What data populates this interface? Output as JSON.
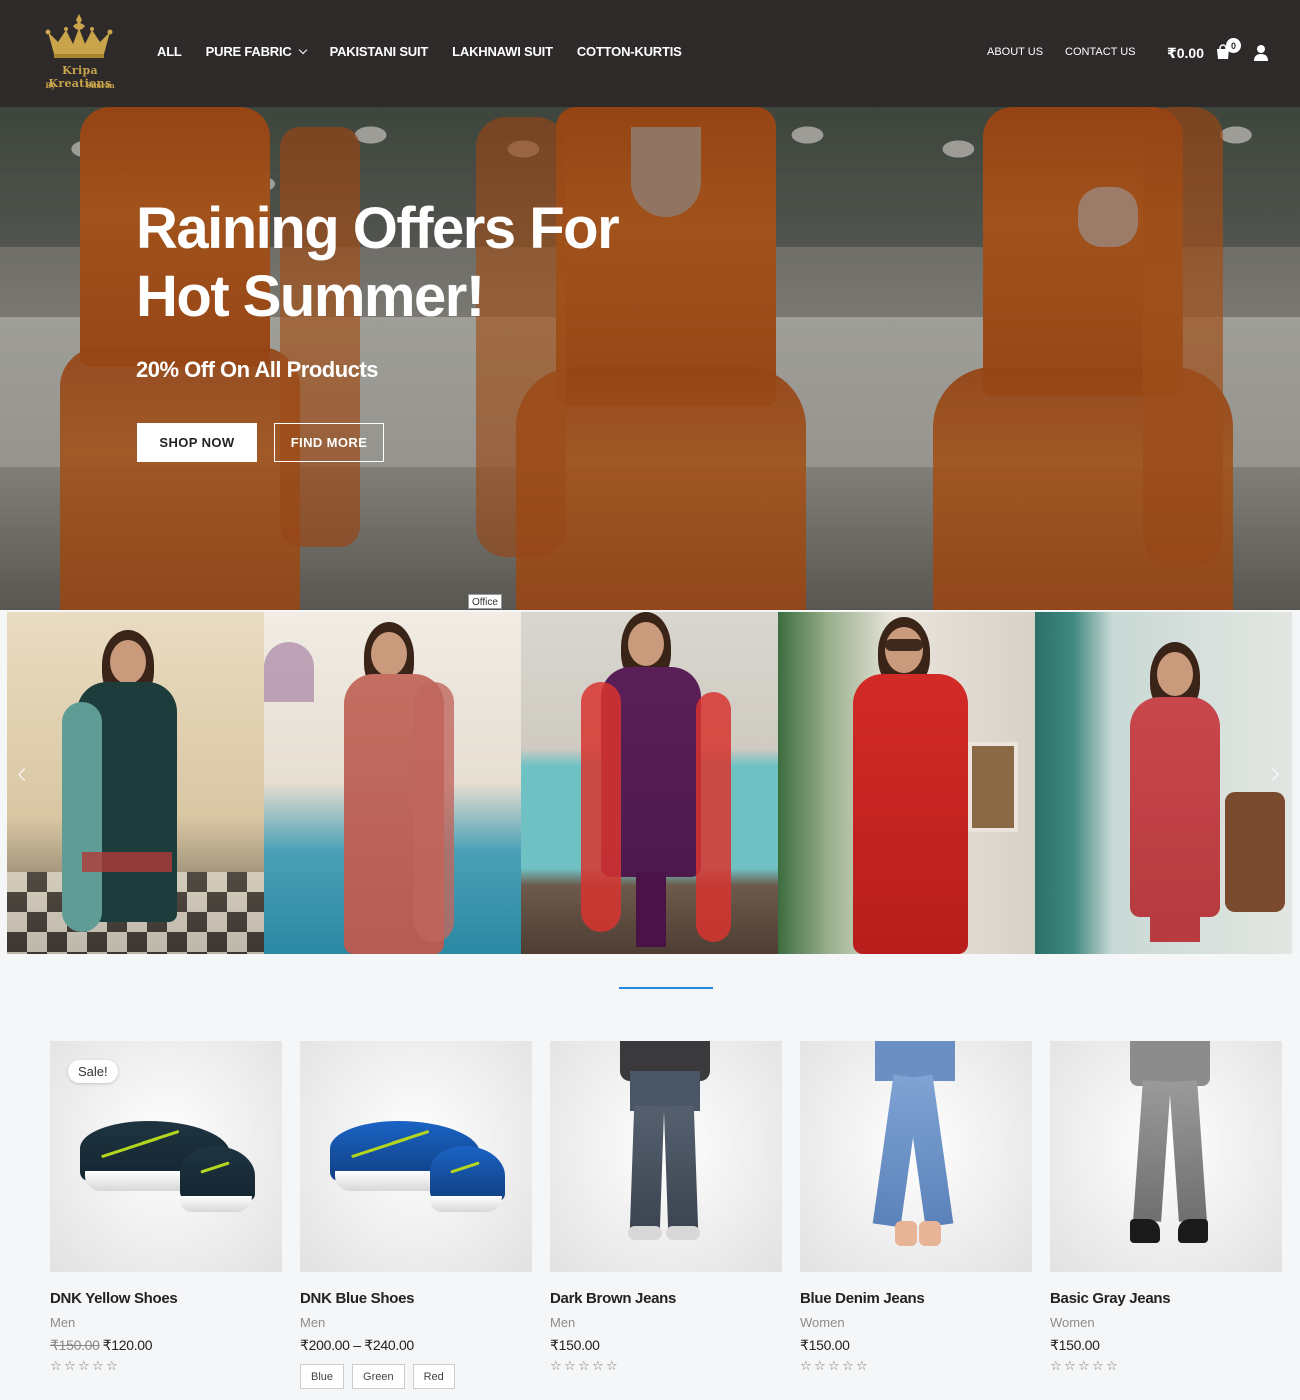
{
  "brand": {
    "name": "Kripa Kreations",
    "by": "By",
    "owner": "Simran"
  },
  "nav": {
    "items": [
      "ALL",
      "PURE FABRIC",
      "PAKISTANI SUIT",
      "LAKHNAWI SUIT",
      "COTTON-KURTIS"
    ],
    "right": [
      "ABOUT US",
      "CONTACT US"
    ],
    "cart_total": "₹0.00",
    "cart_count": "0"
  },
  "hero": {
    "title": "Raining Offers For Hot Summer!",
    "subtitle": "20% Off On All Products",
    "shop_button": "SHOP NOW",
    "find_button": "FIND MORE",
    "tag": "Office"
  },
  "products": [
    {
      "name": "DNK Yellow Shoes",
      "category": "Men",
      "old_price": "₹150.00",
      "price": "₹120.00",
      "badge": "Sale!",
      "rating": 0
    },
    {
      "name": "DNK Blue Shoes",
      "category": "Men",
      "price": "₹200.00 – ₹240.00",
      "swatches": [
        "Blue",
        "Green",
        "Red"
      ],
      "rating": 0
    },
    {
      "name": "Dark Brown Jeans",
      "category": "Men",
      "price": "₹150.00",
      "rating": 0
    },
    {
      "name": "Blue Denim Jeans",
      "category": "Women",
      "price": "₹150.00",
      "rating": 0
    },
    {
      "name": "Basic Gray Jeans",
      "category": "Women",
      "price": "₹150.00",
      "rating": 0
    }
  ],
  "colors": {
    "header_bg": "#2f2a2a",
    "brand_gold": "#c9a44a",
    "accent_blue": "#1e88e5",
    "dress_orange": "#e07327"
  }
}
